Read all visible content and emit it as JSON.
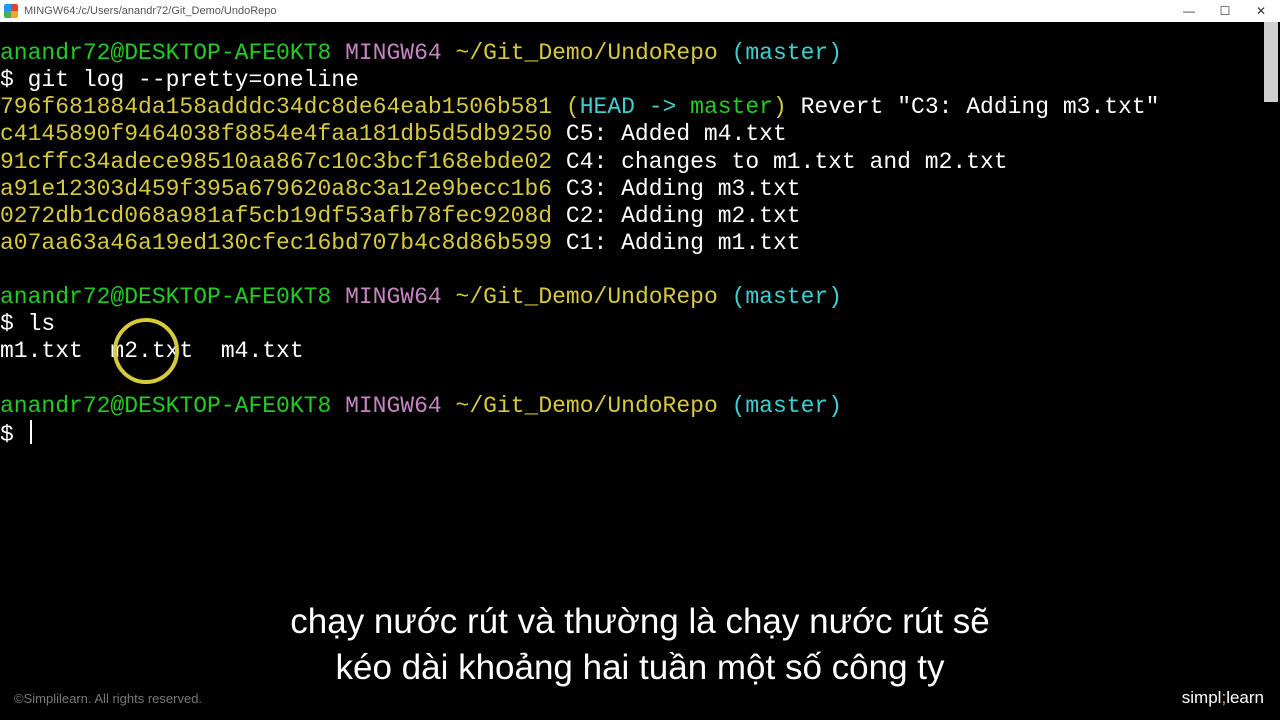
{
  "window": {
    "title": "MINGW64:/c/Users/anandr72/Git_Demo/UndoRepo"
  },
  "prompt": {
    "user_host": "anandr72@DESKTOP-AFE0KT8",
    "env": "MINGW64",
    "path": "~/Git_Demo/UndoRepo",
    "branch": "(master)",
    "sigil": "$"
  },
  "cmd1": "git log --pretty=oneline",
  "log": [
    {
      "hash": "796f681884da158adddc34dc8de64eab1506b581",
      "head": "HEAD -> ",
      "head_target": "master",
      "msg": "Revert \"C3: Adding m3.txt\""
    },
    {
      "hash": "c4145890f9464038f8854e4faa181db5d5db9250",
      "msg": "C5: Added m4.txt"
    },
    {
      "hash": "91cffc34adece98510aa867c10c3bcf168ebde02",
      "msg": "C4: changes to m1.txt and m2.txt"
    },
    {
      "hash": "a91e12303d459f395a679620a8c3a12e9becc1b6",
      "msg": "C3: Adding m3.txt"
    },
    {
      "hash": "0272db1cd068a981af5cb19df53afb78fec9208d",
      "msg": "C2: Adding m2.txt"
    },
    {
      "hash": "a07aa63a46a19ed130cfec16bd707b4c8d86b599",
      "msg": "C1: Adding m1.txt"
    }
  ],
  "cmd2": "ls",
  "ls_output": "m1.txt  m2.txt  m4.txt",
  "caption_line1": "chạy nước rút và thường là chạy nước rút sẽ",
  "caption_line2": "kéo dài khoảng hai tuần một số công ty",
  "copyright": "©Simplilearn. All rights reserved.",
  "brand_prefix": "simpl",
  "brand_suffix": "learn"
}
